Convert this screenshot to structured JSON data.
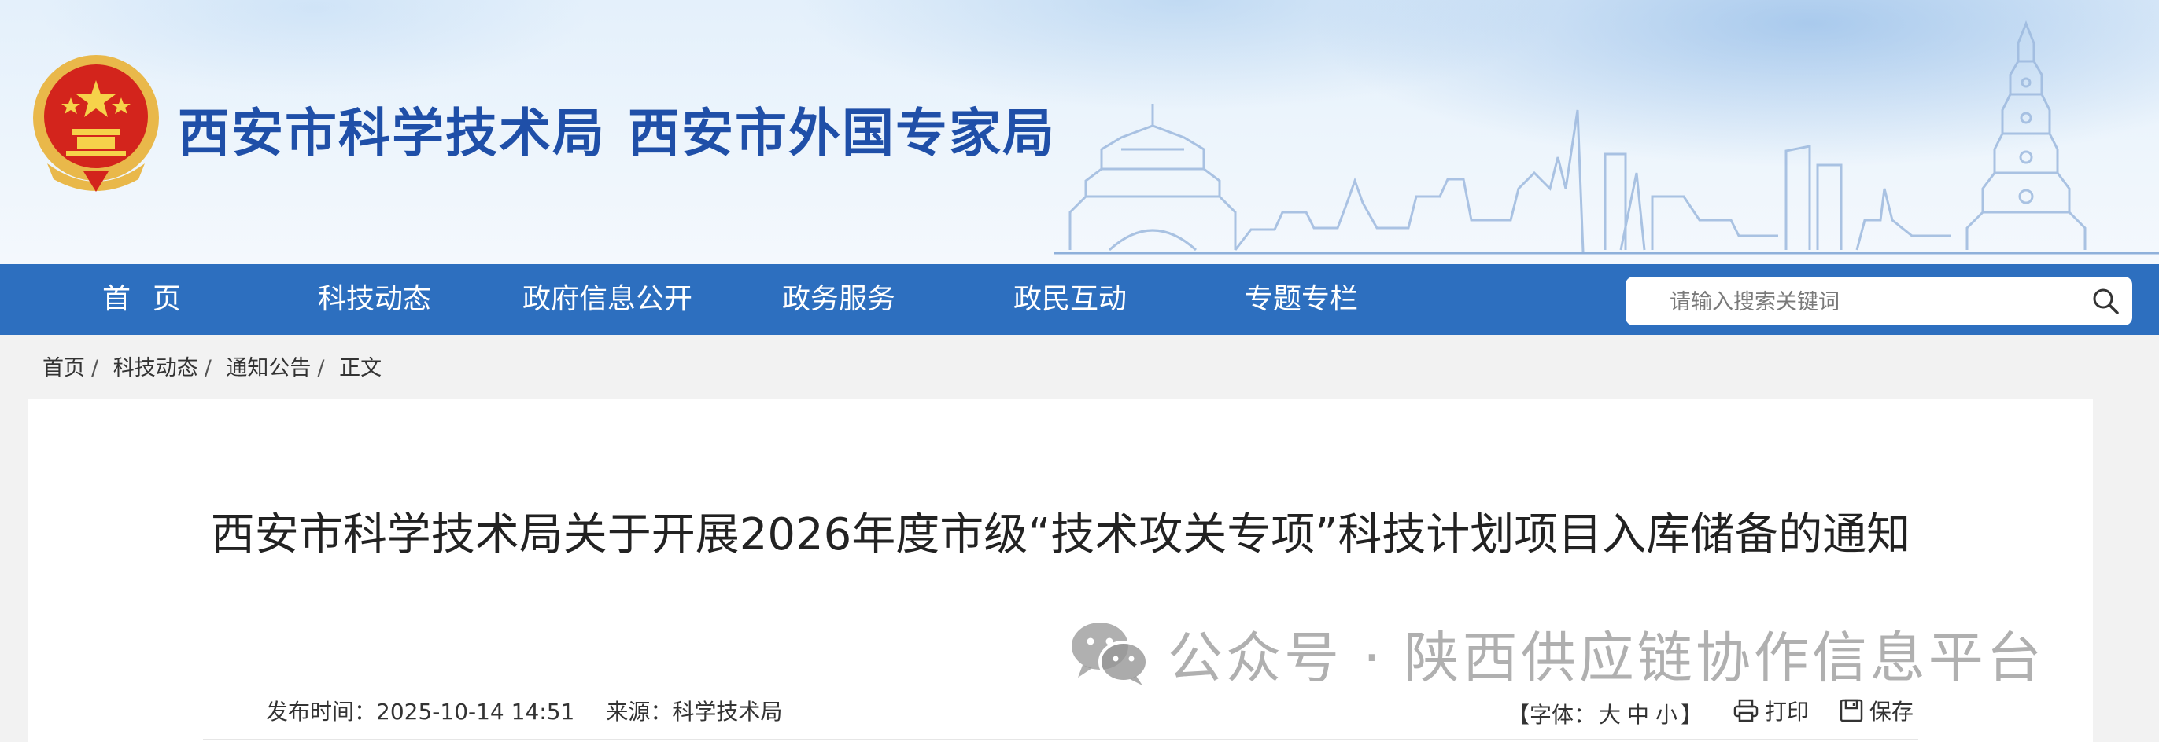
{
  "header": {
    "org_name_1": "西安市科学技术局",
    "org_name_2": "西安市外国专家局",
    "brand_color": "#1f4fa8"
  },
  "nav": {
    "bg_color": "#2d6fbf",
    "items": [
      {
        "label": "首页"
      },
      {
        "label": "科技动态"
      },
      {
        "label": "政府信息公开"
      },
      {
        "label": "政务服务"
      },
      {
        "label": "政民互动"
      },
      {
        "label": "专题专栏"
      }
    ],
    "search": {
      "placeholder": "请输入搜索关键词",
      "icon": "search-icon"
    }
  },
  "breadcrumb": {
    "items": [
      "首页",
      "科技动态",
      "通知公告",
      "正文"
    ]
  },
  "article": {
    "title": "西安市科学技术局关于开展2026年度市级“技术攻关专项”科技计划项目入库储备的通知",
    "publish_label": "发布时间：",
    "publish_time": "2025-10-14 14:51",
    "source_label": "来源：",
    "source": "科学技术局",
    "font_size_prefix": "【字体：",
    "font_size_options": [
      "大",
      "中",
      "小"
    ],
    "font_size_suffix": "】",
    "print_label": "打印",
    "save_label": "保存"
  },
  "watermark": {
    "text": "公众号 · 陕西供应链协作信息平台",
    "icon": "wechat-icon"
  }
}
